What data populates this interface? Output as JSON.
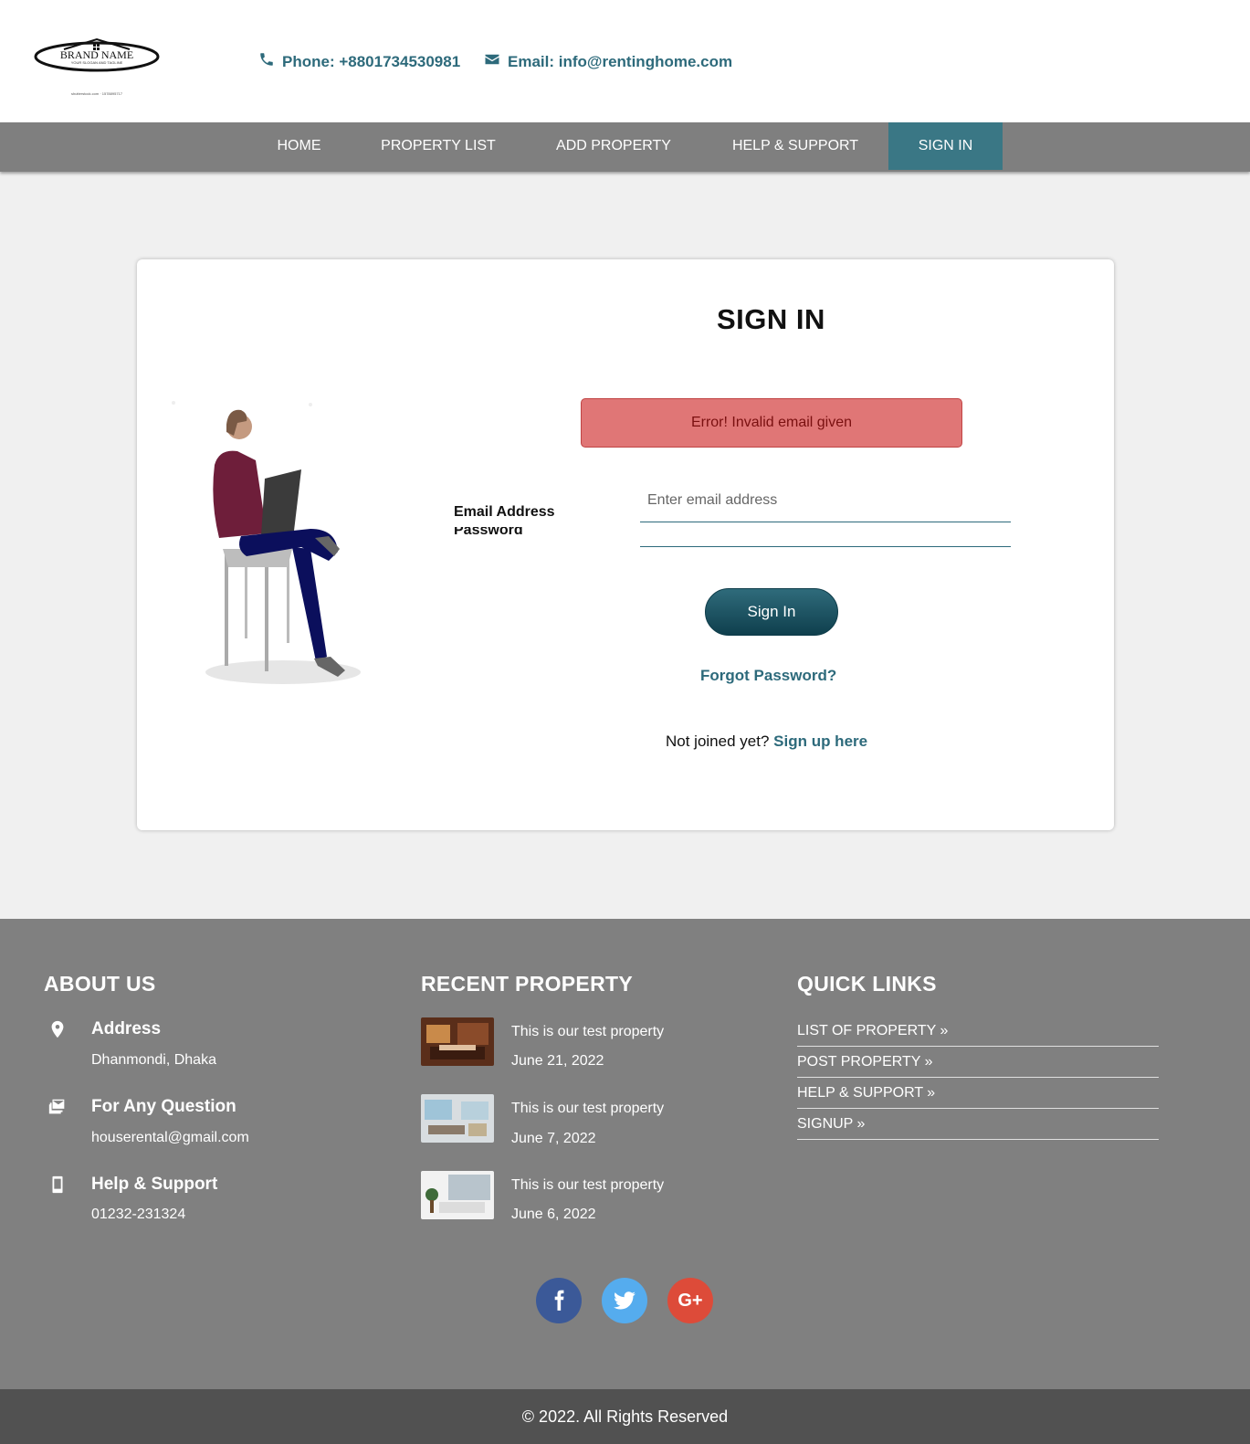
{
  "header": {
    "brand_name": "BRAND NAME",
    "brand_tagline": "YOUR SLOGAN AND TAGLINE",
    "brand_credit": "shutterstock.com · 1578895717",
    "phone": "Phone: +8801734530981",
    "email": "Email: info@rentinghome.com"
  },
  "nav": {
    "items": [
      {
        "label": "HOME"
      },
      {
        "label": "PROPERTY LIST"
      },
      {
        "label": "ADD PROPERTY"
      },
      {
        "label": "HELP & SUPPORT"
      },
      {
        "label": "SIGN IN",
        "active": true
      }
    ],
    "active_color": "#3a7785"
  },
  "signin": {
    "title": "SIGN IN",
    "error": "Error! Invalid email given",
    "email_label": "Email Address",
    "email_placeholder": "Enter email address",
    "email_value": "",
    "password_label": "Password",
    "password_value": "",
    "button": "Sign In",
    "forgot": "Forgot Password?",
    "not_joined": "Not joined yet?",
    "signup_link": "Sign up here"
  },
  "footer": {
    "about": {
      "title": "ABOUT US",
      "items": [
        {
          "icon": "map-pin-icon",
          "heading": "Address",
          "text": "Dhanmondi, Dhaka"
        },
        {
          "icon": "mail-stack-icon",
          "heading": "For Any Question",
          "text": "houserental@gmail.com"
        },
        {
          "icon": "mobile-icon",
          "heading": "Help & Support",
          "text": "01232-231324"
        }
      ]
    },
    "recent": {
      "title": "RECENT PROPERTY",
      "items": [
        {
          "title": "This is our test property",
          "date": "June 21, 2022"
        },
        {
          "title": "This is our test property",
          "date": "June 7, 2022"
        },
        {
          "title": "This is our test property",
          "date": "June 6, 2022"
        }
      ]
    },
    "quick": {
      "title": "QUICK LINKS",
      "links": [
        "LIST OF PROPERTY »",
        "POST PROPERTY »",
        "HELP & SUPPORT »",
        "SIGNUP »"
      ]
    },
    "social": [
      {
        "name": "facebook-icon",
        "color": "#3b5998"
      },
      {
        "name": "twitter-icon",
        "color": "#55acee"
      },
      {
        "name": "google-plus-icon",
        "color": "#dd4b39"
      }
    ],
    "google_plus_glyph": "G+",
    "copyright": "© 2022. All Rights Reserved"
  }
}
